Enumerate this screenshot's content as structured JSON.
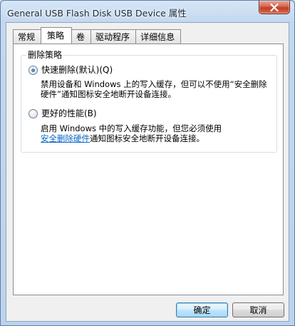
{
  "window": {
    "title": "General USB Flash Disk USB Device 属性"
  },
  "tabs": [
    {
      "label": "常规",
      "active": false
    },
    {
      "label": "策略",
      "active": true
    },
    {
      "label": "卷",
      "active": false
    },
    {
      "label": "驱动程序",
      "active": false
    },
    {
      "label": "详细信息",
      "active": false
    }
  ],
  "removal_policy": {
    "group_label": "删除策略",
    "quick_removal": {
      "label": "快速删除(默认)(Q)",
      "checked": true,
      "description_prefix": "禁用设备和 Windows 上的写入缓存，但可以不使用“安全删除硬件”通知图标安全地断开设备连接。"
    },
    "better_performance": {
      "label": "更好的性能(B)",
      "checked": false,
      "description_prefix": "启用 Windows 中的写入缓存功能，但您必须使用",
      "link_text": "安全删除硬件",
      "description_suffix": "通知图标安全地断开设备连接。"
    }
  },
  "buttons": {
    "ok": "确定",
    "cancel": "取消"
  },
  "icons": {
    "close": "close-icon"
  },
  "colors": {
    "link": "#0b66c2",
    "close_button": "#c23b22"
  }
}
